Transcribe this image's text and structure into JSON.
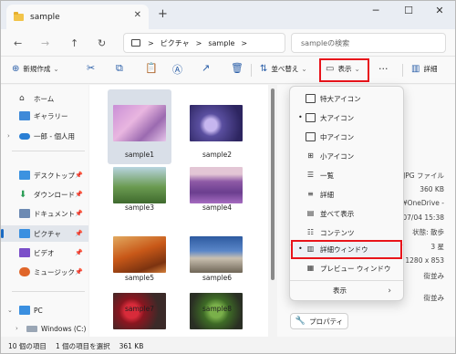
{
  "window": {
    "tab_title": "sample",
    "tab_close": "✕",
    "new_tab": "+",
    "minimize": "─",
    "maximize": "☐",
    "close": "✕"
  },
  "address": {
    "back": "←",
    "forward": "→",
    "up": "↑",
    "refresh": "↻",
    "path": [
      "ピクチャ",
      "sample"
    ],
    "separator": ">",
    "search_placeholder": "sampleの検索"
  },
  "toolbar": {
    "new_label": "新規作成",
    "sort_label": "並べ替え",
    "view_label": "表示",
    "more": "···",
    "details_label": "詳細"
  },
  "sidebar": {
    "items": [
      {
        "label": "ホーム",
        "icon": "home-icon"
      },
      {
        "label": "ギャラリー",
        "icon": "gallery-icon"
      },
      {
        "label": "一郎 - 個人用",
        "icon": "onedrive-icon"
      },
      {
        "label": "デスクトップ",
        "icon": "desktop-icon"
      },
      {
        "label": "ダウンロード",
        "icon": "download-icon"
      },
      {
        "label": "ドキュメント",
        "icon": "documents-icon"
      },
      {
        "label": "ピクチャ",
        "icon": "pictures-icon"
      },
      {
        "label": "ビデオ",
        "icon": "video-icon"
      },
      {
        "label": "ミュージック",
        "icon": "music-icon"
      },
      {
        "label": "PC",
        "icon": "pc-icon"
      },
      {
        "label": "Windows (C:)",
        "icon": "drive-icon"
      }
    ]
  },
  "files": [
    {
      "name": "sample1"
    },
    {
      "name": "sample2"
    },
    {
      "name": "sample3"
    },
    {
      "name": "sample4"
    },
    {
      "name": "sample5"
    },
    {
      "name": "sample6"
    },
    {
      "name": "sample7"
    },
    {
      "name": "sample8"
    }
  ],
  "details_pane": {
    "type": "JPG ファイル",
    "size": "360 KB",
    "location": "¥OneDrive -",
    "date": "4/07/04 15:38",
    "status": "状態: 散歩",
    "stars": "3 星",
    "dimensions": "1280 x 853",
    "edit_owner": "街並み",
    "tag": "街並み",
    "properties_label": "プロパティ"
  },
  "view_menu": {
    "items": [
      {
        "label": "特大アイコン",
        "selected": false
      },
      {
        "label": "大アイコン",
        "selected": true
      },
      {
        "label": "中アイコン",
        "selected": false
      },
      {
        "label": "小アイコン",
        "selected": false
      },
      {
        "label": "一覧",
        "selected": false
      },
      {
        "label": "詳細",
        "selected": false
      },
      {
        "label": "並べて表示",
        "selected": false
      },
      {
        "label": "コンテンツ",
        "selected": false
      },
      {
        "label": "詳細ウィンドウ",
        "selected": true
      },
      {
        "label": "プレビュー ウィンドウ",
        "selected": false
      },
      {
        "label": "表示",
        "selected": false
      }
    ],
    "bullet": "•",
    "submenu_arrow": "›"
  },
  "status": {
    "count": "10 個の項目",
    "selected": "1 個の項目を選択",
    "size": "361 KB"
  },
  "colors": {
    "highlight": "#e8141b",
    "accent": "#1a6ac3"
  }
}
